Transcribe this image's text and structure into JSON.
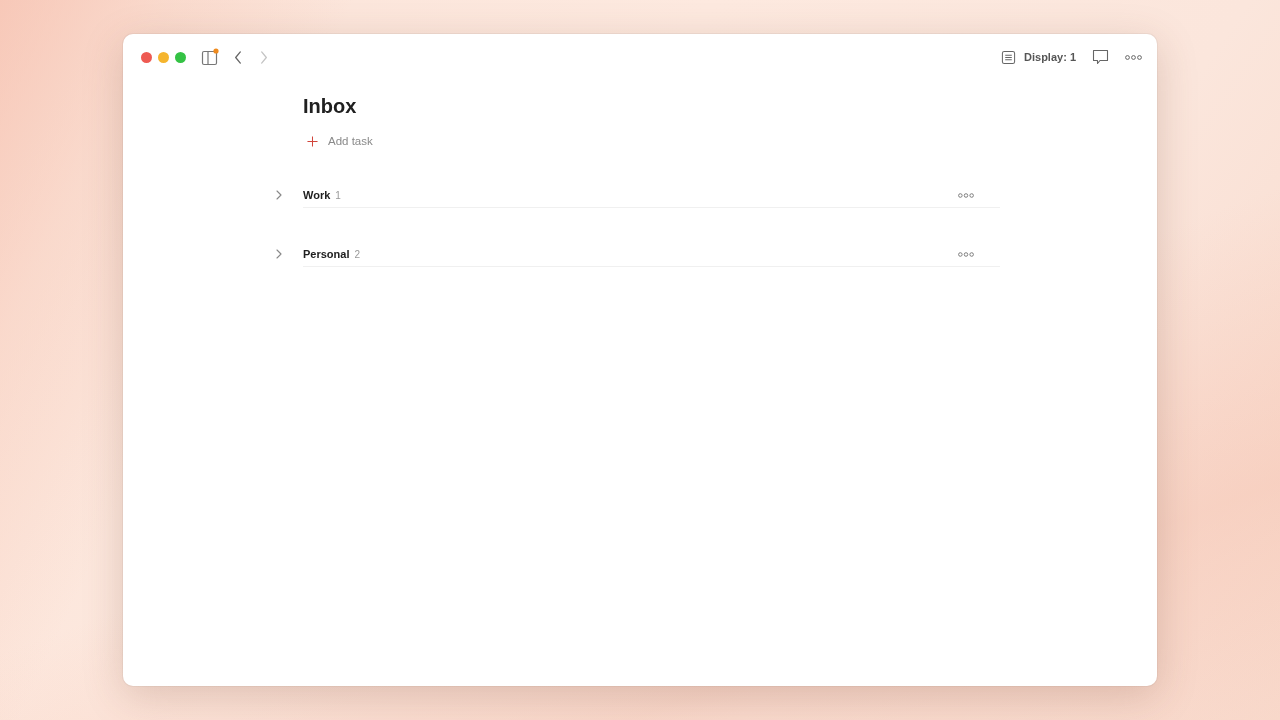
{
  "toolbar": {
    "sidebar_toggle": {
      "badge": true
    },
    "back_button": {
      "disabled": false
    },
    "forward_button": {
      "disabled": true
    },
    "display_button": {
      "label": "Display: 1"
    }
  },
  "page": {
    "title": "Inbox",
    "add_task": {
      "label": "Add task"
    }
  },
  "sections": [
    {
      "name": "Work",
      "count": "1",
      "expanded": false
    },
    {
      "name": "Personal",
      "count": "2",
      "expanded": false
    }
  ]
}
